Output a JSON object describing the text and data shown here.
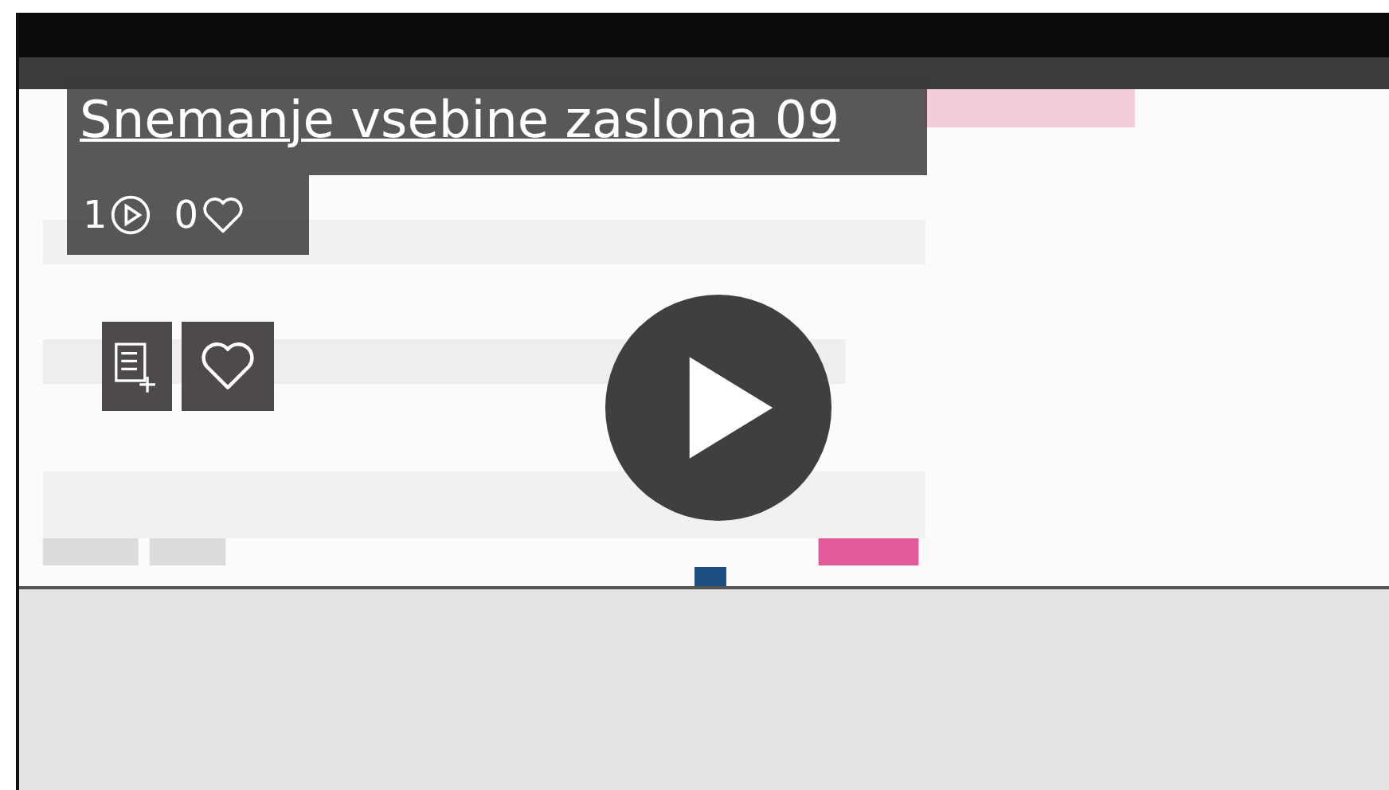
{
  "video": {
    "title": "Snemanje vsebine zaslona 09",
    "views": "1",
    "likes": "0"
  }
}
